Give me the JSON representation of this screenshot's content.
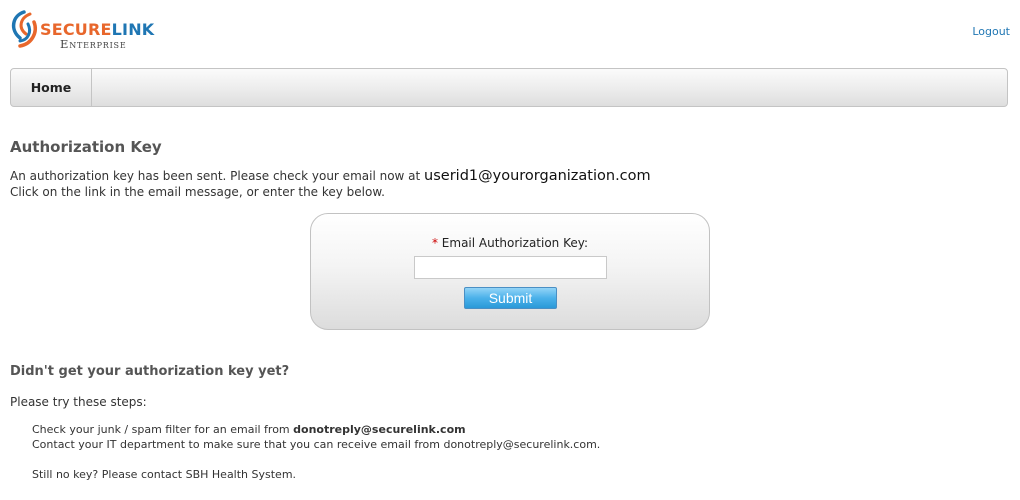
{
  "brand": {
    "name_part1": "SECURE",
    "name_part2": "LINK",
    "subtitle": "Enterprise"
  },
  "header": {
    "logout_label": "Logout"
  },
  "nav": {
    "home_label": "Home"
  },
  "page": {
    "title": "Authorization Key",
    "message_line1_prefix": "An authorization key has been sent. Please check your email now at ",
    "message_email": "userid1@yourorganization.com",
    "message_line2": "Click on the link in the email message, or enter the key below."
  },
  "form": {
    "required_marker": "*",
    "key_label": "Email Authorization Key:",
    "key_value": "",
    "submit_label": "Submit"
  },
  "help": {
    "title": "Didn't get your authorization key yet?",
    "intro": "Please try these steps:",
    "step1_prefix": "Check your junk / spam filter for an email from ",
    "step1_email": "donotreply@securelink.com",
    "step2": "Contact your IT department to make sure that you can receive email from donotreply@securelink.com.",
    "still_no_key": "Still no key? Please contact SBH Health System."
  },
  "colors": {
    "brand_orange": "#e8672c",
    "brand_blue": "#1f76b3",
    "link_blue": "#1f76b3",
    "submit_blue": "#4bb1ea",
    "required_red": "#cc0000"
  },
  "icons": {
    "logo": "securelink-swirl-logo-icon"
  }
}
